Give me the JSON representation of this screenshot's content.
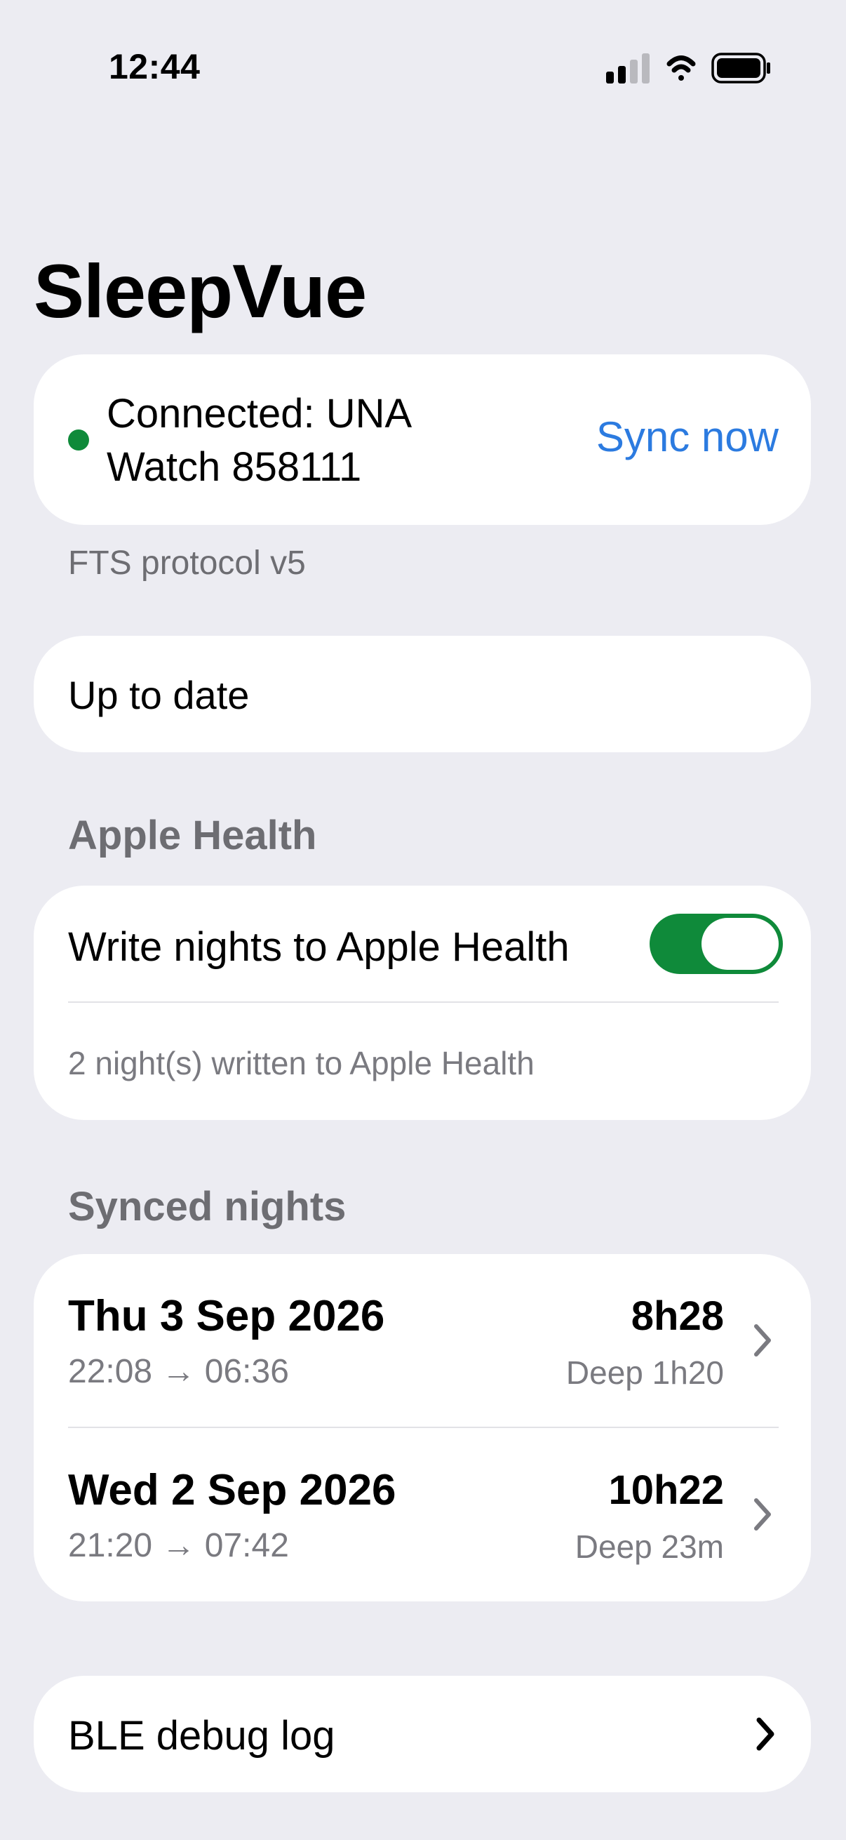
{
  "status_bar": {
    "time": "12:44",
    "icons": [
      "cellular-signal-icon",
      "wifi-icon",
      "battery-icon"
    ]
  },
  "app": {
    "title": "SleepVue"
  },
  "connection": {
    "label": "Connected: UNA Watch 858111",
    "sync_button": "Sync now",
    "protocol": "FTS protocol v5",
    "status_color": "#0F8A3A"
  },
  "sync_status": {
    "text": "Up to date"
  },
  "apple_health": {
    "header": "Apple Health",
    "toggle_label": "Write nights to Apple Health",
    "toggle_on": true,
    "summary": "2 night(s) written to Apple Health"
  },
  "synced_nights": {
    "header": "Synced nights",
    "items": [
      {
        "date": "Thu 3 Sep 2026",
        "times": "22:08 → 06:36",
        "duration": "8h28",
        "deep": "Deep 1h20"
      },
      {
        "date": "Wed 2 Sep 2026",
        "times": "21:20 → 07:42",
        "duration": "10h22",
        "deep": "Deep 23m"
      }
    ]
  },
  "debug": {
    "label": "BLE debug log"
  },
  "colors": {
    "accent": "#2C7BE0",
    "toggle_on": "#0F8A3A",
    "background": "#ECECF2"
  }
}
